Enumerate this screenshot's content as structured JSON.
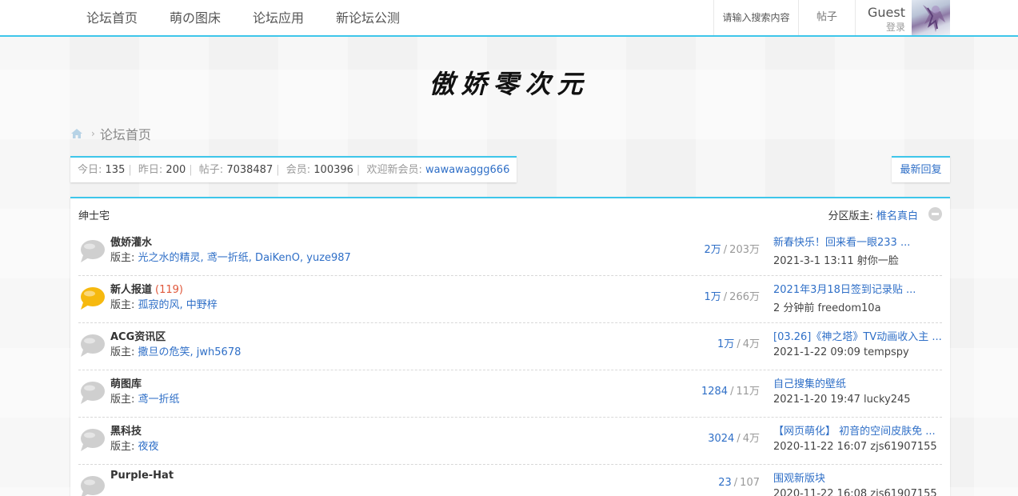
{
  "nav": [
    "论坛首页",
    "萌の图床",
    "论坛应用",
    "新论坛公测"
  ],
  "header": {
    "search_placeholder": "请输入搜索内容",
    "posts_label": "帖子",
    "user_name": "Guest",
    "login_label": "登录"
  },
  "logo_text": "傲娇零次元",
  "breadcrumb": {
    "current": "论坛首页"
  },
  "stats": {
    "today_label": "今日:",
    "today": "135",
    "yesterday_label": "昨日:",
    "yesterday": "200",
    "posts_label": "帖子:",
    "posts": "7038487",
    "members_label": "会员:",
    "members": "100396",
    "newest_label": "欢迎新会员:",
    "newest": "wawawaggg666"
  },
  "latest_reply_label": "最新回复",
  "category": {
    "title": "绅士宅",
    "moderator_label": "分区版主:",
    "moderator": "椎名真白"
  },
  "moderator_prefix": "版主:",
  "forums": [
    {
      "name": "傲娇灌水",
      "new_count": "",
      "mods": "光之水的精灵, 鸢一折纸, DaiKenO, yuze987",
      "threads": "2万",
      "posts": "203万",
      "last_title": "新春快乐！回来看一眼233 ...",
      "last_meta": "2021-3-1 13:11 射你一脸",
      "icon_color": "#cfcfcf"
    },
    {
      "name": "新人报道",
      "new_count": "(119)",
      "mods": "孤寂的风, 中野梓",
      "threads": "1万",
      "posts": "266万",
      "last_title": "2021年3月18日签到记录贴 ...",
      "last_meta": "2 分钟前 freedom10a",
      "icon_color": "#f6b90f"
    },
    {
      "name": "ACG资讯区",
      "new_count": "",
      "mods": "撒旦の危笑, jwh5678",
      "threads": "1万",
      "posts": "4万",
      "last_title": "[03.26]《神之塔》TV动画收入主 ...",
      "last_meta": "2021-1-22 09:09 tempspy",
      "icon_color": "#cfcfcf"
    },
    {
      "name": "萌图库",
      "new_count": "",
      "mods": "鸢一折纸",
      "threads": "1284",
      "posts": "11万",
      "last_title": "自己搜集的壁纸",
      "last_meta": "2021-1-20 19:47 lucky245",
      "icon_color": "#cfcfcf"
    },
    {
      "name": "黑科技",
      "new_count": "",
      "mods": "夜夜",
      "threads": "3024",
      "posts": "4万",
      "last_title": "【网页萌化】 初音的空间皮肤免 ...",
      "last_meta": "2020-11-22 16:07 zjs61907155",
      "icon_color": "#cfcfcf"
    },
    {
      "name": "Purple-Hat",
      "new_count": "",
      "mods": "",
      "threads": "23",
      "posts": "107",
      "last_title": "围观新版块",
      "last_meta": "2020-11-22 16:08 zjs61907155",
      "icon_color": "#cfcfcf"
    }
  ]
}
